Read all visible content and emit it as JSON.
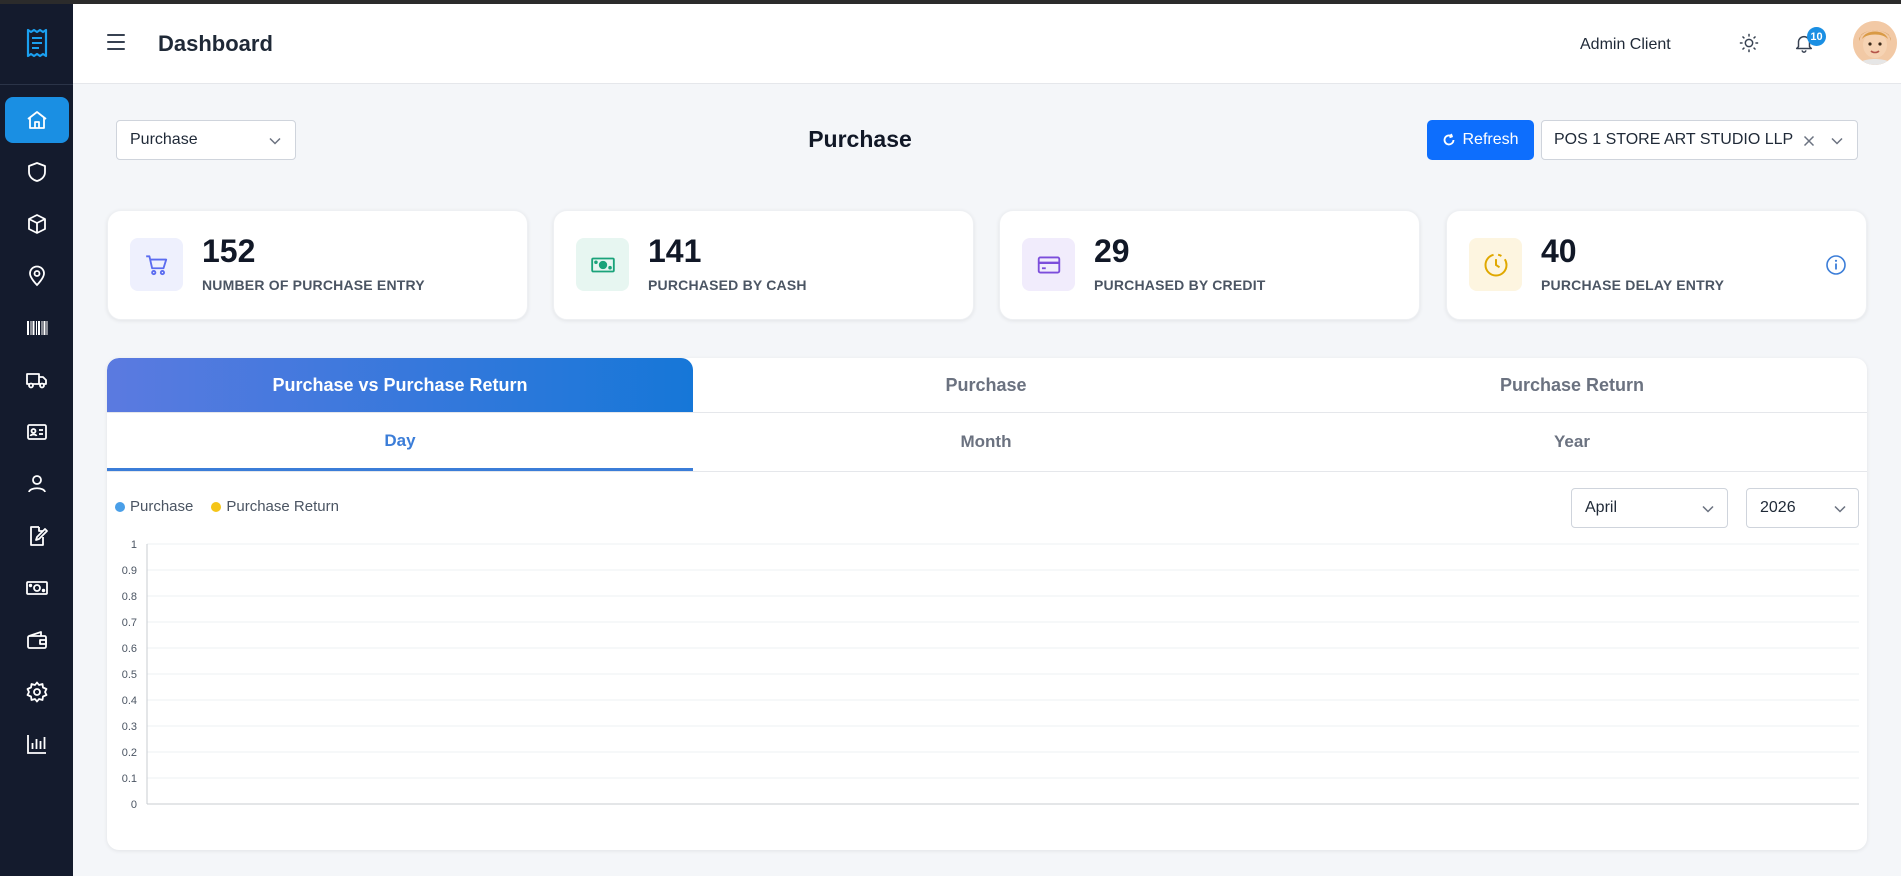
{
  "header": {
    "title": "Dashboard",
    "user_name": "Admin Client",
    "notification_count": "10"
  },
  "sidebar": {
    "items": [
      {
        "icon": "home-icon",
        "active": true
      },
      {
        "icon": "shield-icon",
        "active": false
      },
      {
        "icon": "box-icon",
        "active": false
      },
      {
        "icon": "location-pin-icon",
        "active": false
      },
      {
        "icon": "barcode-icon",
        "active": false
      },
      {
        "icon": "truck-icon",
        "active": false
      },
      {
        "icon": "id-card-icon",
        "active": false
      },
      {
        "icon": "user-icon",
        "active": false
      },
      {
        "icon": "edit-document-icon",
        "active": false
      },
      {
        "icon": "cash-icon",
        "active": false
      },
      {
        "icon": "wallet-icon",
        "active": false
      },
      {
        "icon": "gear-icon",
        "active": false
      },
      {
        "icon": "bar-chart-icon",
        "active": false
      }
    ],
    "accent": "#1a8fe3"
  },
  "filters": {
    "type_select": "Purchase",
    "refresh_label": "Refresh",
    "store_select": "POS 1 STORE ART STUDIO LLP"
  },
  "page_title": "Purchase",
  "stats": [
    {
      "value": "152",
      "label": "NUMBER OF PURCHASE ENTRY",
      "icon": "cart-icon",
      "color": "#5b6cf0",
      "bg": "#eef0fd"
    },
    {
      "value": "141",
      "label": "PURCHASED BY CASH",
      "icon": "cash-icon",
      "color": "#1aa37a",
      "bg": "#e7f6f1"
    },
    {
      "value": "29",
      "label": "PURCHASED BY CREDIT",
      "icon": "credit-card-icon",
      "color": "#7c4ddb",
      "bg": "#f1ecfc"
    },
    {
      "value": "40",
      "label": "PURCHASE DELAY ENTRY",
      "icon": "clock-icon",
      "color": "#e0a800",
      "bg": "#fdf5e0"
    }
  ],
  "tabs": [
    "Purchase vs Purchase Return",
    "Purchase",
    "Purchase Return"
  ],
  "subtabs": [
    "Day",
    "Month",
    "Year"
  ],
  "period": {
    "month": "April",
    "year": "2026"
  },
  "chart_data": {
    "type": "line",
    "series": [
      {
        "name": "Purchase",
        "color": "#4a9fe8",
        "values": []
      },
      {
        "name": "Purchase Return",
        "color": "#f5c518",
        "values": []
      }
    ],
    "yticks": [
      "1",
      "0.9",
      "0.8",
      "0.7",
      "0.6",
      "0.5",
      "0.4",
      "0.3",
      "0.2",
      "0.1",
      "0"
    ],
    "ylim": [
      0,
      1
    ],
    "grid": true,
    "legend": "top-left"
  }
}
